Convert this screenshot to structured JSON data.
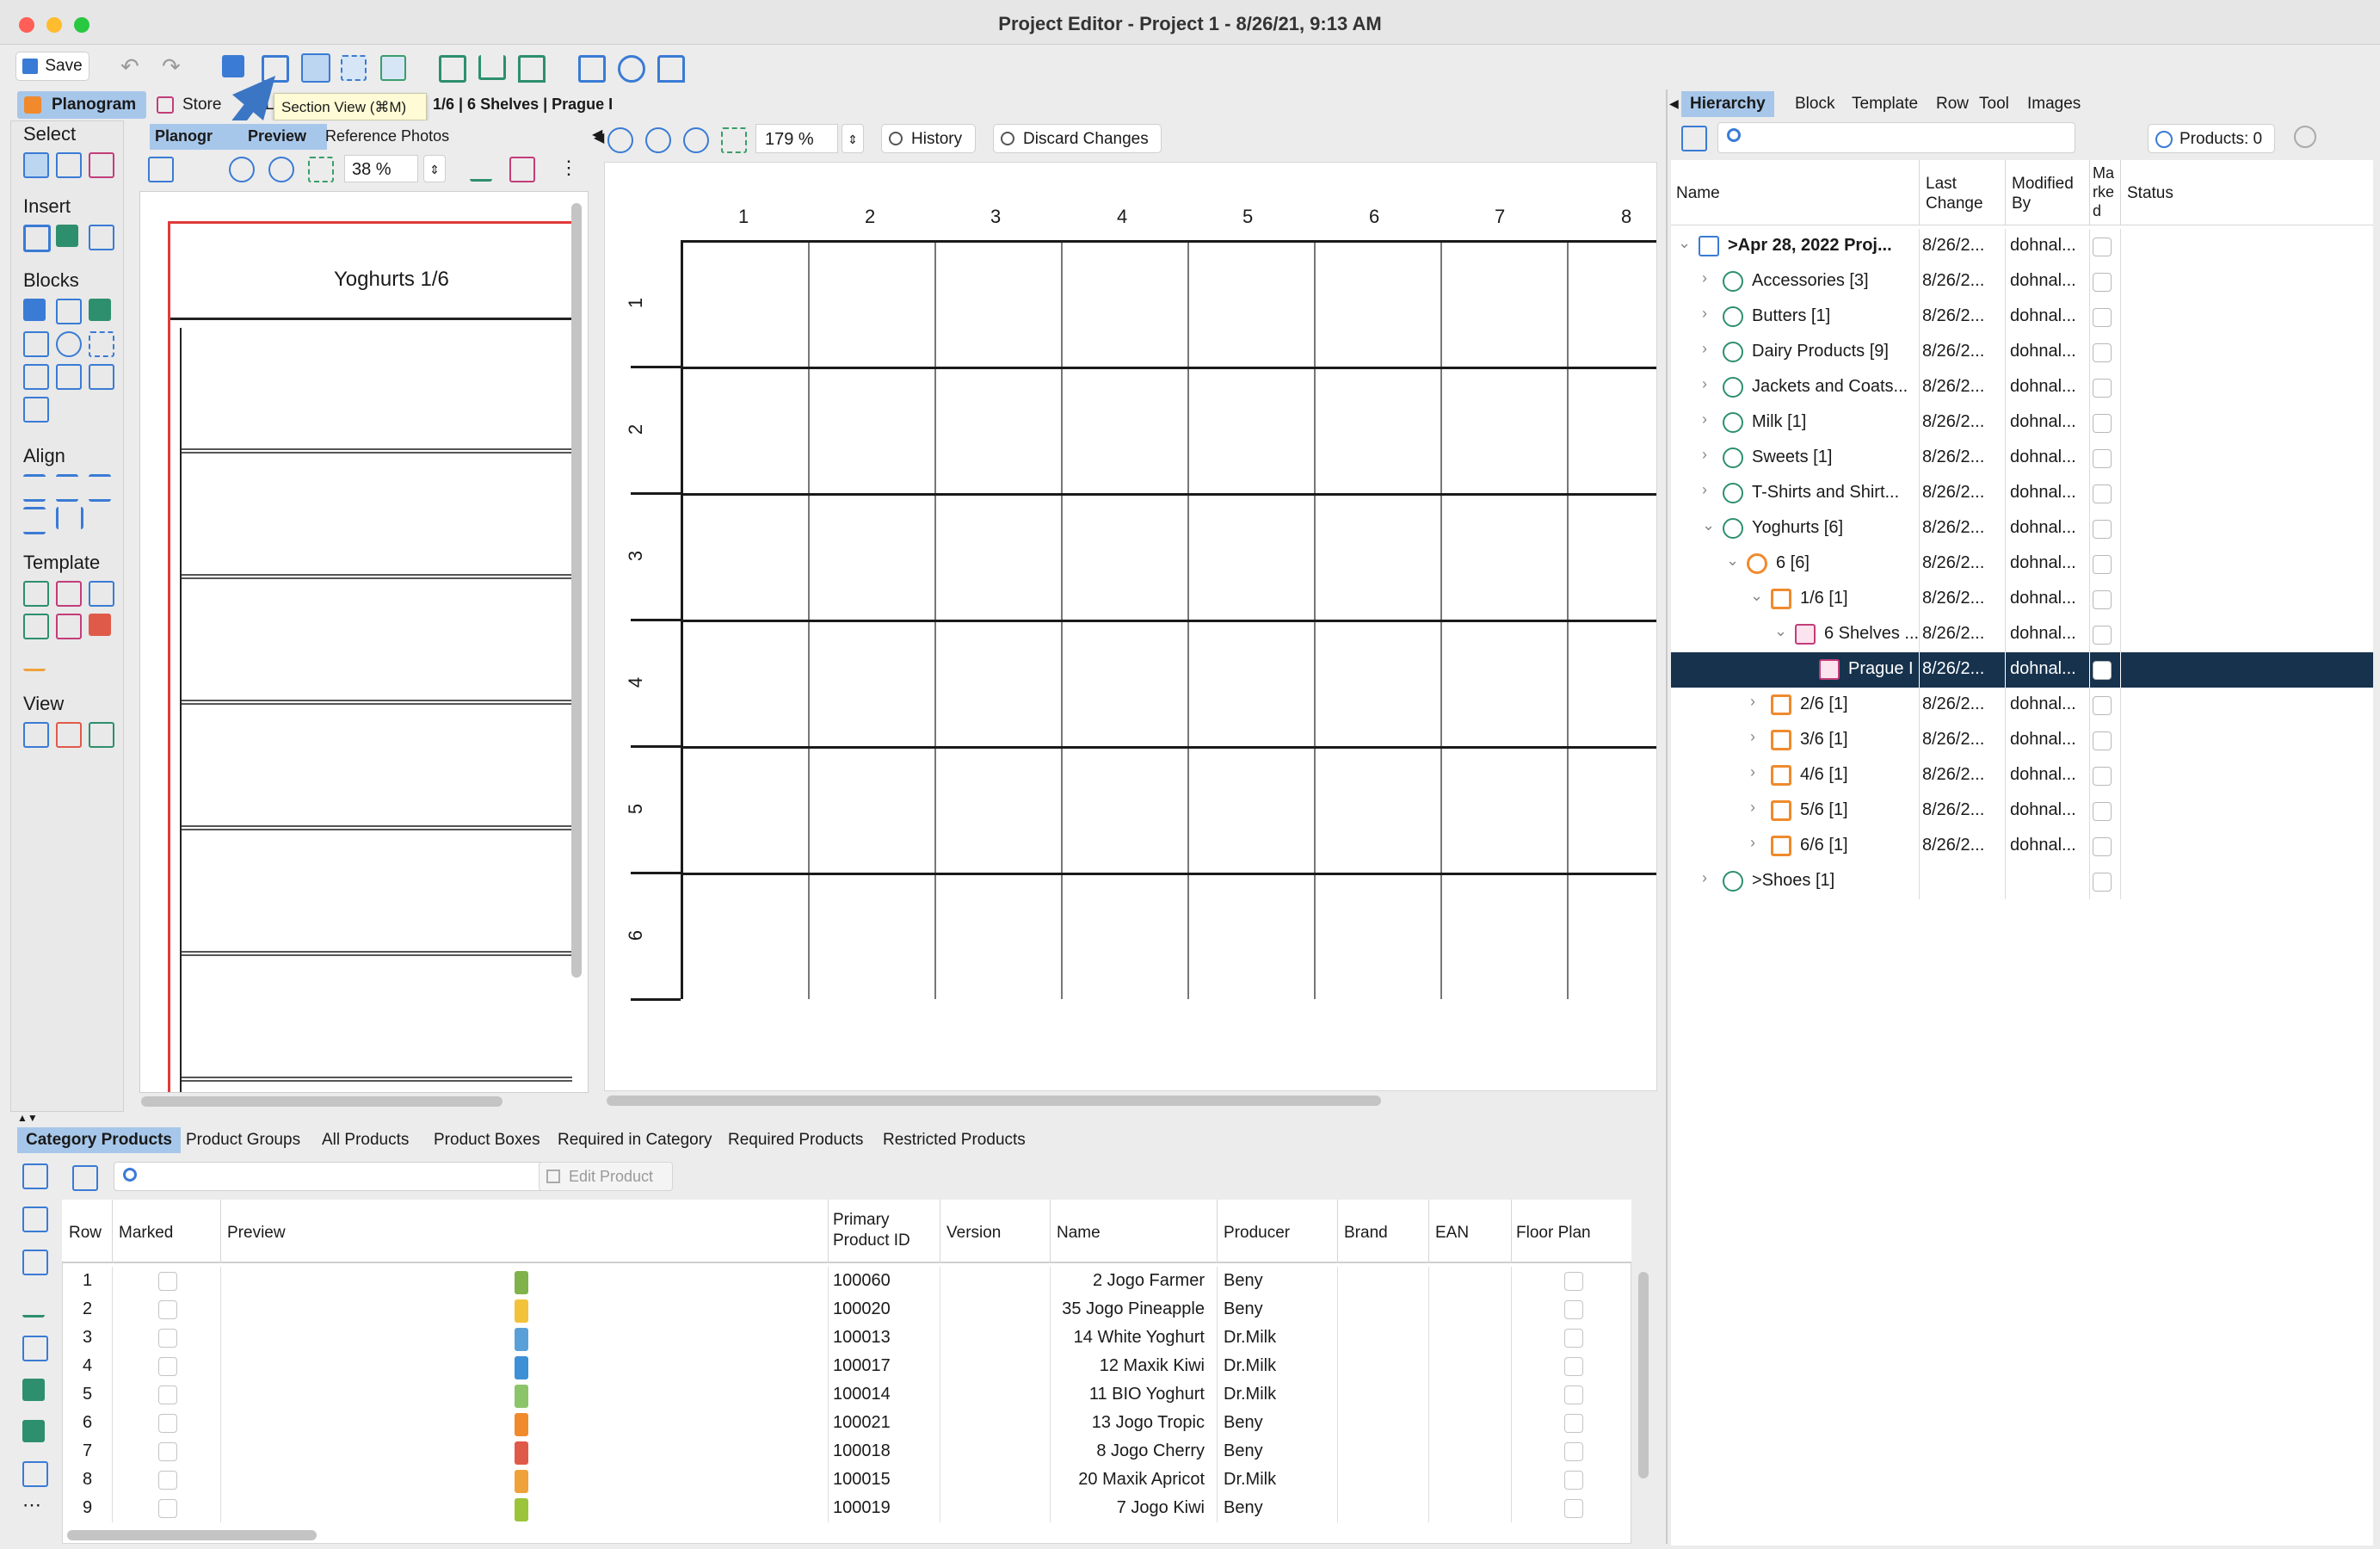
{
  "window": {
    "title": "Project Editor - Project 1 - 8/26/21, 9:13 AM"
  },
  "toolbar": {
    "save_label": "Save"
  },
  "tooltip": {
    "text": "Section View (⌘M)"
  },
  "nav_tabs": {
    "planogram": "Planogram",
    "store": "Store",
    "layout": "Li",
    "path": "1/6 | 6 Shelves | Prague I"
  },
  "sidebar": {
    "select": "Select",
    "insert": "Insert",
    "blocks": "Blocks",
    "align": "Align",
    "template": "Template",
    "view": "View"
  },
  "preview": {
    "tab_planogram": "Planogr",
    "tab_preview": "Preview",
    "tab_photos": "Reference Photos",
    "zoom": "38 %",
    "title": "Yoghurts 1/6"
  },
  "editor": {
    "zoom": "179 %",
    "history": "History",
    "discard": "Discard Changes",
    "columns": [
      "1",
      "2",
      "3",
      "4",
      "5",
      "6",
      "7",
      "8"
    ],
    "rows": [
      "1",
      "2",
      "3",
      "4",
      "5",
      "6"
    ]
  },
  "right_tabs": {
    "hierarchy": "Hierarchy",
    "block": "Block",
    "template": "Template",
    "row": "Row",
    "tool": "Tool",
    "images": "Images"
  },
  "right_toolbar": {
    "products": "Products: 0"
  },
  "hierarchy": {
    "headers": {
      "name": "Name",
      "last_change": "Last Change",
      "modified_by": "Modified By",
      "marked": "Ma rke d",
      "status": "Status"
    },
    "rows": [
      {
        "name": ">Apr 28, 2022 Proj...",
        "date": "8/26/2...",
        "by": "dohnal..."
      },
      {
        "name": "Accessories [3]",
        "date": "8/26/2...",
        "by": "dohnal..."
      },
      {
        "name": "Butters [1]",
        "date": "8/26/2...",
        "by": "dohnal..."
      },
      {
        "name": "Dairy Products [9]",
        "date": "8/26/2...",
        "by": "dohnal..."
      },
      {
        "name": "Jackets and Coats...",
        "date": "8/26/2...",
        "by": "dohnal..."
      },
      {
        "name": "Milk [1]",
        "date": "8/26/2...",
        "by": "dohnal..."
      },
      {
        "name": "Sweets [1]",
        "date": "8/26/2...",
        "by": "dohnal..."
      },
      {
        "name": "T-Shirts and Shirt...",
        "date": "8/26/2...",
        "by": "dohnal..."
      },
      {
        "name": "Yoghurts [6]",
        "date": "8/26/2...",
        "by": "dohnal..."
      },
      {
        "name": "6 [6]",
        "date": "8/26/2...",
        "by": "dohnal..."
      },
      {
        "name": "1/6 [1]",
        "date": "8/26/2...",
        "by": "dohnal..."
      },
      {
        "name": "6 Shelves ...",
        "date": "8/26/2...",
        "by": "dohnal..."
      },
      {
        "name": "Prague I",
        "date": "8/26/2...",
        "by": "dohnal..."
      },
      {
        "name": "2/6 [1]",
        "date": "8/26/2...",
        "by": "dohnal..."
      },
      {
        "name": "3/6 [1]",
        "date": "8/26/2...",
        "by": "dohnal..."
      },
      {
        "name": "4/6 [1]",
        "date": "8/26/2...",
        "by": "dohnal..."
      },
      {
        "name": "5/6 [1]",
        "date": "8/26/2...",
        "by": "dohnal..."
      },
      {
        "name": "6/6 [1]",
        "date": "8/26/2...",
        "by": "dohnal..."
      },
      {
        "name": ">Shoes [1]",
        "date": "",
        "by": ""
      }
    ]
  },
  "bottom_tabs": [
    "Category Products",
    "Product Groups",
    "All Products",
    "Product Boxes",
    "Required in Category",
    "Required Products",
    "Restricted Products"
  ],
  "bottom_toolbar": {
    "edit_product": "Edit Product"
  },
  "products": {
    "headers": {
      "row": "Row",
      "marked": "Marked",
      "preview": "Preview",
      "primary_id": "Primary Product ID",
      "version": "Version",
      "name": "Name",
      "producer": "Producer",
      "brand": "Brand",
      "ean": "EAN",
      "floor_plan": "Floor Plan"
    },
    "rows": [
      {
        "row": "1",
        "id": "100060",
        "name": "2 Jogo Farmer",
        "producer": "Beny",
        "color": "#7fb24a"
      },
      {
        "row": "2",
        "id": "100020",
        "name": "35 Jogo Pineapple",
        "producer": "Beny",
        "color": "#f2c23a"
      },
      {
        "row": "3",
        "id": "100013",
        "name": "14 White Yoghurt",
        "producer": "Dr.Milk",
        "color": "#5aa0d8"
      },
      {
        "row": "4",
        "id": "100017",
        "name": "12 Maxik Kiwi",
        "producer": "Dr.Milk",
        "color": "#3d8fd6"
      },
      {
        "row": "5",
        "id": "100014",
        "name": "11 BIO Yoghurt",
        "producer": "Dr.Milk",
        "color": "#8cc46a"
      },
      {
        "row": "6",
        "id": "100021",
        "name": "13 Jogo Tropic",
        "producer": "Beny",
        "color": "#f08a2c"
      },
      {
        "row": "7",
        "id": "100018",
        "name": "8 Jogo Cherry",
        "producer": "Beny",
        "color": "#e05a4a"
      },
      {
        "row": "8",
        "id": "100015",
        "name": "20 Maxik Apricot",
        "producer": "Dr.Milk",
        "color": "#f0a23a"
      },
      {
        "row": "9",
        "id": "100019",
        "name": "7 Jogo Kiwi",
        "producer": "Beny",
        "color": "#9cc43a"
      }
    ]
  }
}
